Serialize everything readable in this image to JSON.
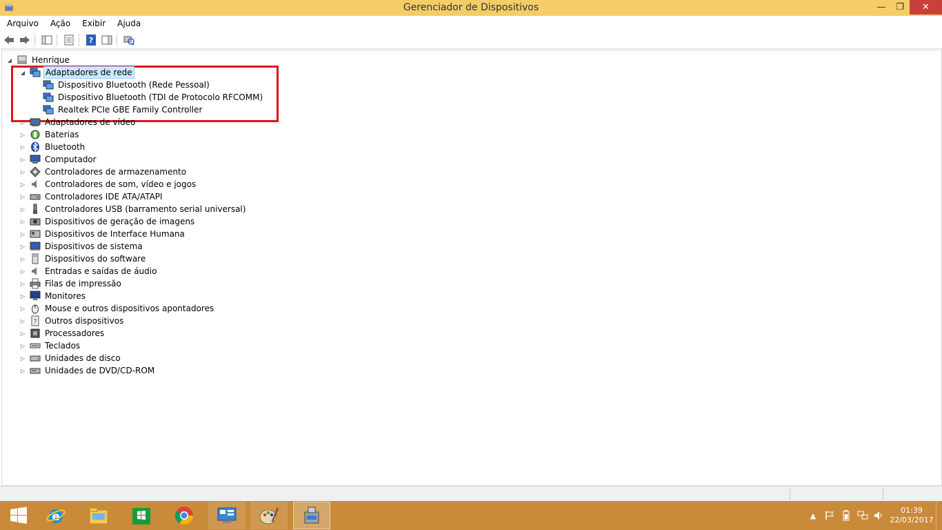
{
  "window": {
    "title": "Gerenciador de Dispositivos",
    "minimize": "—",
    "maximize": "❐",
    "close": "✕"
  },
  "menu": [
    "Arquivo",
    "Ação",
    "Exibir",
    "Ajuda"
  ],
  "toolbar": {
    "icons": [
      "back-arrow-icon",
      "forward-arrow-icon",
      "show-hide-tree-icon",
      "properties-icon",
      "help-icon",
      "action-pane-icon",
      "scan-hardware-icon"
    ]
  },
  "tree": {
    "root": "Henrique",
    "expanded_category": "Adaptadores de rede",
    "expanded_children": [
      "Dispositivo Bluetooth (Rede Pessoal)",
      "Dispositivo Bluetooth (TDI de Protocolo RFCOMM)",
      "Realtek PCIe GBE Family Controller"
    ],
    "categories": [
      "Adaptadores de vídeo",
      "Baterias",
      "Bluetooth",
      "Computador",
      "Controladores de armazenamento",
      "Controladores de som, vídeo e jogos",
      "Controladores IDE ATA/ATAPI",
      "Controladores USB (barramento serial universal)",
      "Dispositivos de geração de imagens",
      "Dispositivos de Interface Humana",
      "Dispositivos de sistema",
      "Dispositivos do software",
      "Entradas e saídas de áudio",
      "Filas de impressão",
      "Monitores",
      "Mouse e outros dispositivos apontadores",
      "Outros dispositivos",
      "Processadores",
      "Teclados",
      "Unidades de disco",
      "Unidades de DVD/CD-ROM"
    ]
  },
  "taskbar": {
    "apps": [
      "start-icon",
      "internet-explorer-icon",
      "file-explorer-icon",
      "store-icon",
      "chrome-icon",
      "control-panel-icon",
      "paint-icon",
      "device-manager-icon"
    ]
  },
  "clock": {
    "time": "01:39",
    "date": "22/03/2017"
  },
  "colors": {
    "titlebar": "#f5cd66",
    "taskbar": "#c98a3a",
    "highlight": "#e0141e",
    "selection": "#cce8ff"
  }
}
